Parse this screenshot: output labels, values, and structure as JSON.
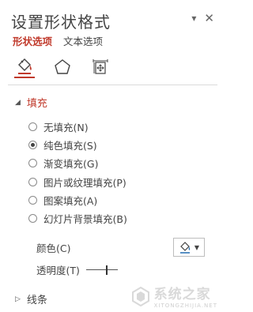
{
  "panel": {
    "title": "设置形状格式"
  },
  "tabs": [
    {
      "label": "形状选项",
      "active": true
    },
    {
      "label": "文本选项",
      "active": false
    }
  ],
  "fill_section": {
    "title": "填充",
    "options": [
      {
        "label": "无填充(N)",
        "checked": false
      },
      {
        "label": "纯色填充(S)",
        "checked": true
      },
      {
        "label": "渐变填充(G)",
        "checked": false
      },
      {
        "label": "图片或纹理填充(P)",
        "checked": false
      },
      {
        "label": "图案填充(A)",
        "checked": false
      },
      {
        "label": "幻灯片背景填充(B)",
        "checked": false
      }
    ],
    "color_label": "颜色(C)",
    "transparency_label": "透明度(T)",
    "transparency_value": 0.65
  },
  "line_section": {
    "title": "线条"
  },
  "watermark": {
    "text": "系统之家",
    "url": "XITONGZHIJIA.NET"
  },
  "colors": {
    "accent": "#c0392b",
    "bucket": "#2e75b6"
  }
}
